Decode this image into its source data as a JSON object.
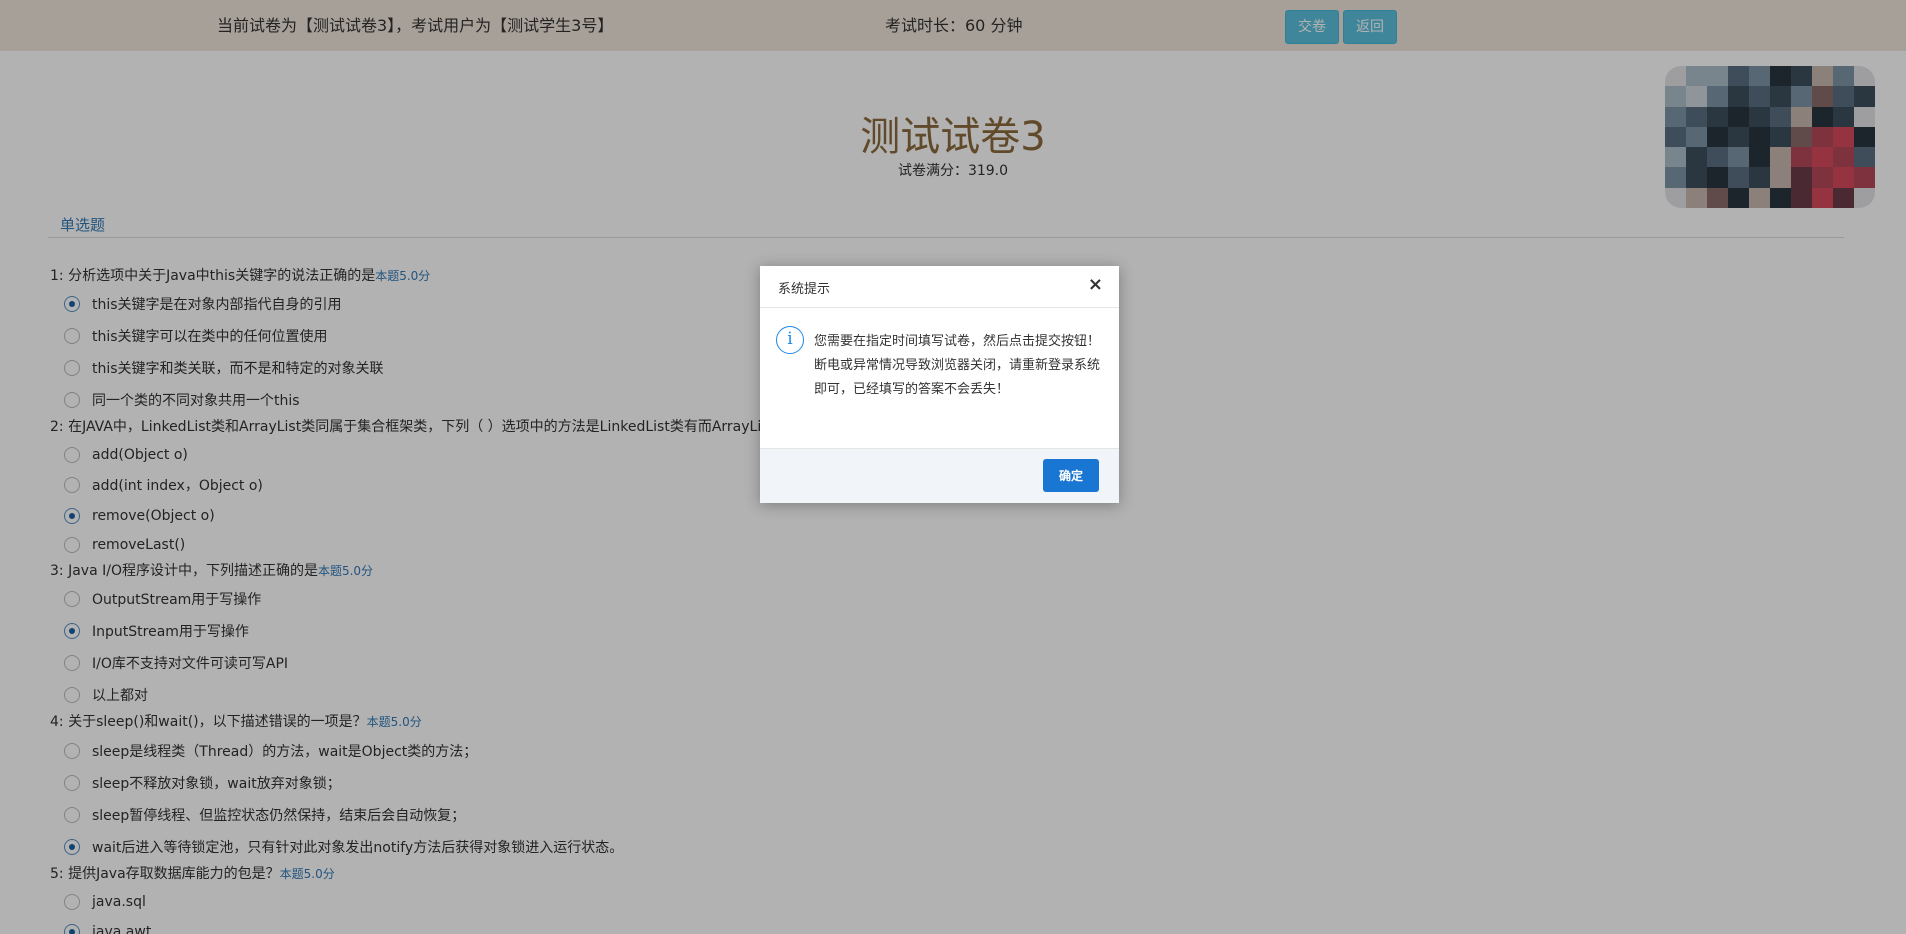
{
  "header": {
    "paper_info": "当前试卷为【测试试卷3】，考试用户为【测试学生3号】",
    "duration": "考试时长：60 分钟",
    "submit_label": "交卷",
    "back_label": "返回"
  },
  "exam": {
    "title": "测试试卷3",
    "score": "试卷满分：319.0",
    "section": "单选题"
  },
  "questions": [
    {
      "text": "1: 分析选项中关于Java中this关键字的说法正确的是",
      "points": "本题5.0分",
      "options": [
        "this关键字是在对象内部指代自身的引用",
        "this关键字可以在类中的任何位置使用",
        "this关键字和类关联，而不是和特定的对象关联",
        "同一个类的不同对象共用一个this"
      ],
      "selected": 0
    },
    {
      "text": "2: 在JAVA中，LinkedList类和ArrayList类同属于集合框架类，下列（ ）选项中的方法是LinkedList类有而ArrayList类",
      "points": "",
      "options": [
        "add(Object o)",
        "add(int index，Object o)",
        "remove(Object o)",
        "removeLast()"
      ],
      "selected": 2
    },
    {
      "text": "3: Java I/O程序设计中，下列描述正确的是",
      "points": "本题5.0分",
      "options": [
        "OutputStream用于写操作",
        "InputStream用于写操作",
        "I/O库不支持对文件可读可写API",
        "以上都对"
      ],
      "selected": 1
    },
    {
      "text": "4: 关于sleep()和wait()，以下描述错误的一项是？",
      "points": "本题5.0分",
      "options": [
        "sleep是线程类（Thread）的方法，wait是Object类的方法；",
        "sleep不释放对象锁，wait放弃对象锁；",
        "sleep暂停线程、但监控状态仍然保持，结束后会自动恢复；",
        "wait后进入等待锁定池，只有针对此对象发出notify方法后获得对象锁进入运行状态。"
      ],
      "selected": 3
    },
    {
      "text": "5: 提供Java存取数据库能力的包是？",
      "points": "本题5.0分",
      "options": [
        "java.sql",
        "java.awt"
      ],
      "selected": 1
    }
  ],
  "modal": {
    "title": "系统提示",
    "close": "×",
    "icon": "i",
    "line1": "您需要在指定时间填写试卷，然后点击提交按钮！",
    "line2": "断电或异常情况导致浏览器关闭，请重新登录系统即可，已经填写的答案不会丢失！",
    "ok_label": "确定"
  },
  "colors": {
    "accent": "#1976d2",
    "topbar": "#efe5da",
    "title": "#8b6a3d",
    "button": "#5bc0de"
  }
}
